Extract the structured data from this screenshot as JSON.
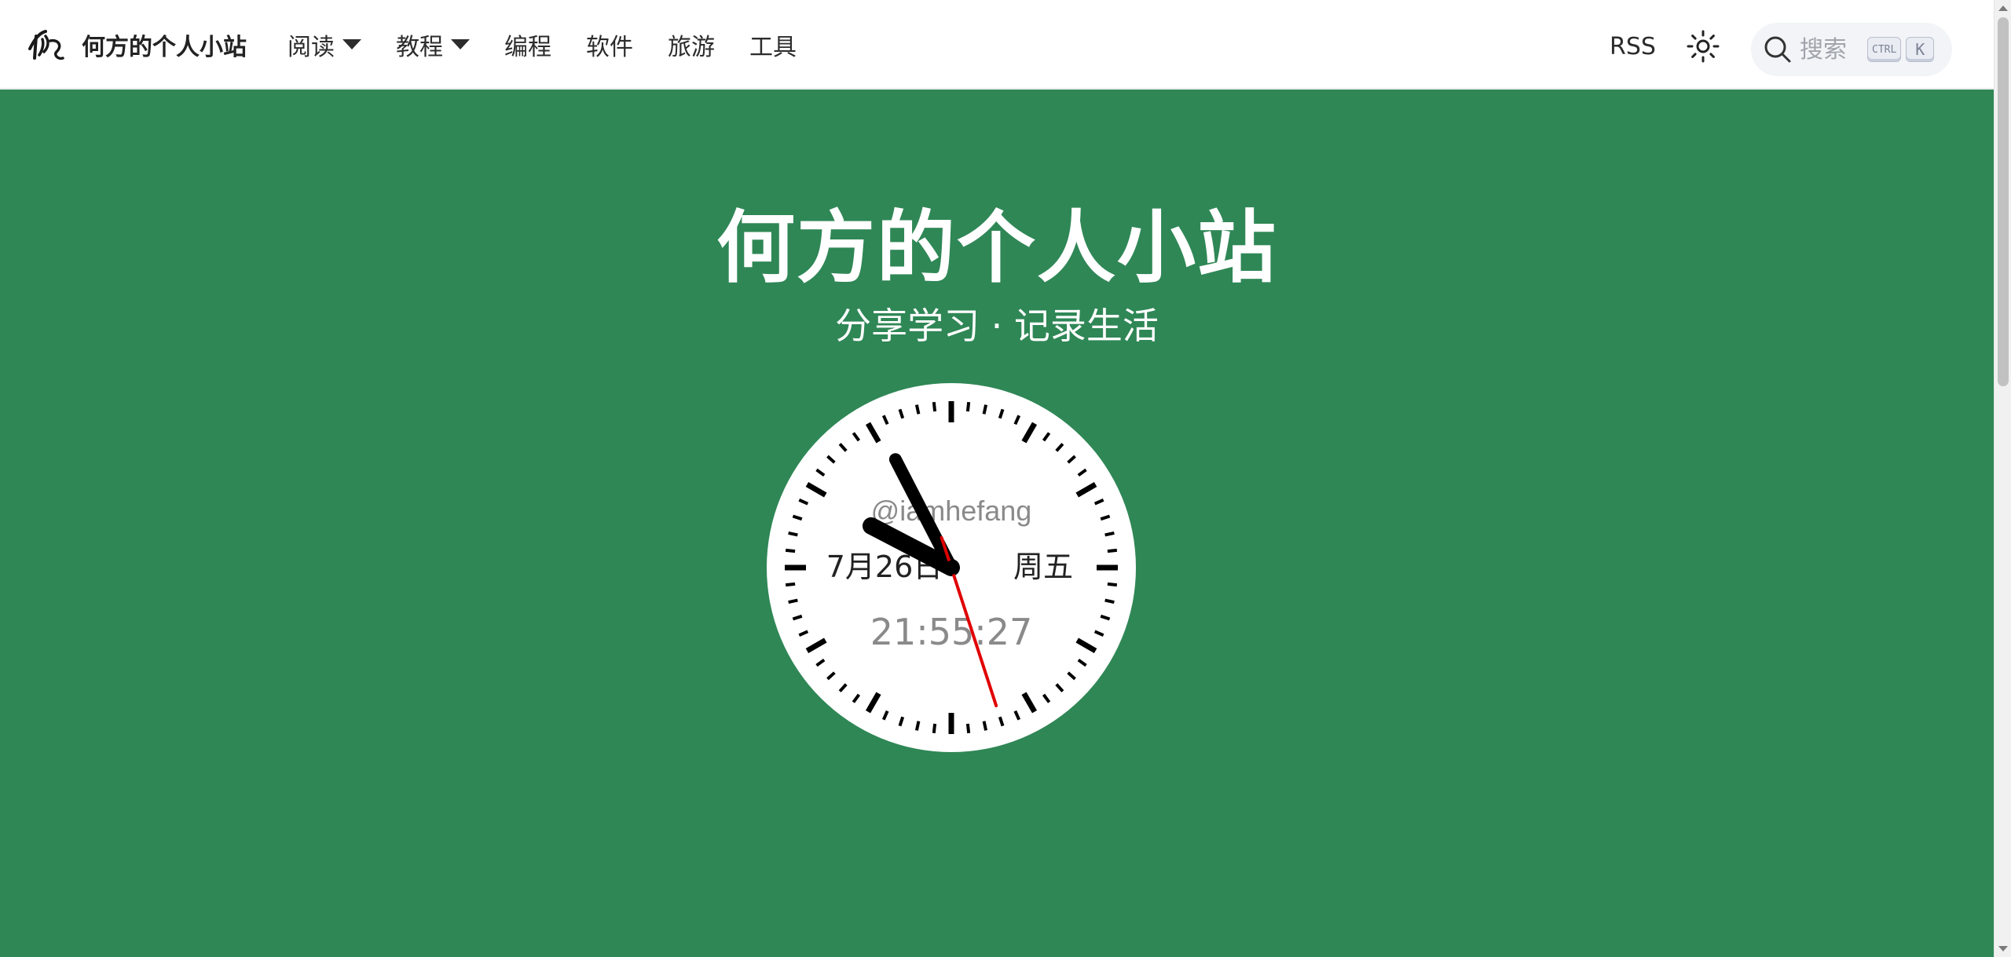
{
  "site": {
    "title": "何方的个人小站"
  },
  "nav": {
    "items": [
      {
        "label": "阅读",
        "has_dropdown": true
      },
      {
        "label": "教程",
        "has_dropdown": true
      },
      {
        "label": "编程",
        "has_dropdown": false
      },
      {
        "label": "软件",
        "has_dropdown": false
      },
      {
        "label": "旅游",
        "has_dropdown": false
      },
      {
        "label": "工具",
        "has_dropdown": false
      }
    ],
    "rss_label": "RSS",
    "theme_icon": "sun-icon"
  },
  "search": {
    "placeholder": "搜索",
    "shortcut_ctrl": "CTRL",
    "shortcut_key": "K"
  },
  "hero": {
    "title": "何方的个人小站",
    "subtitle": "分享学习 · 记录生活",
    "background_color": "#2f8756"
  },
  "clock": {
    "watermark": "@iamhefang",
    "date": "7月26日",
    "weekday": "周五",
    "time": "21:55:27",
    "hours": 21,
    "minutes": 55,
    "seconds": 27,
    "second_hand_color": "#e00000"
  }
}
